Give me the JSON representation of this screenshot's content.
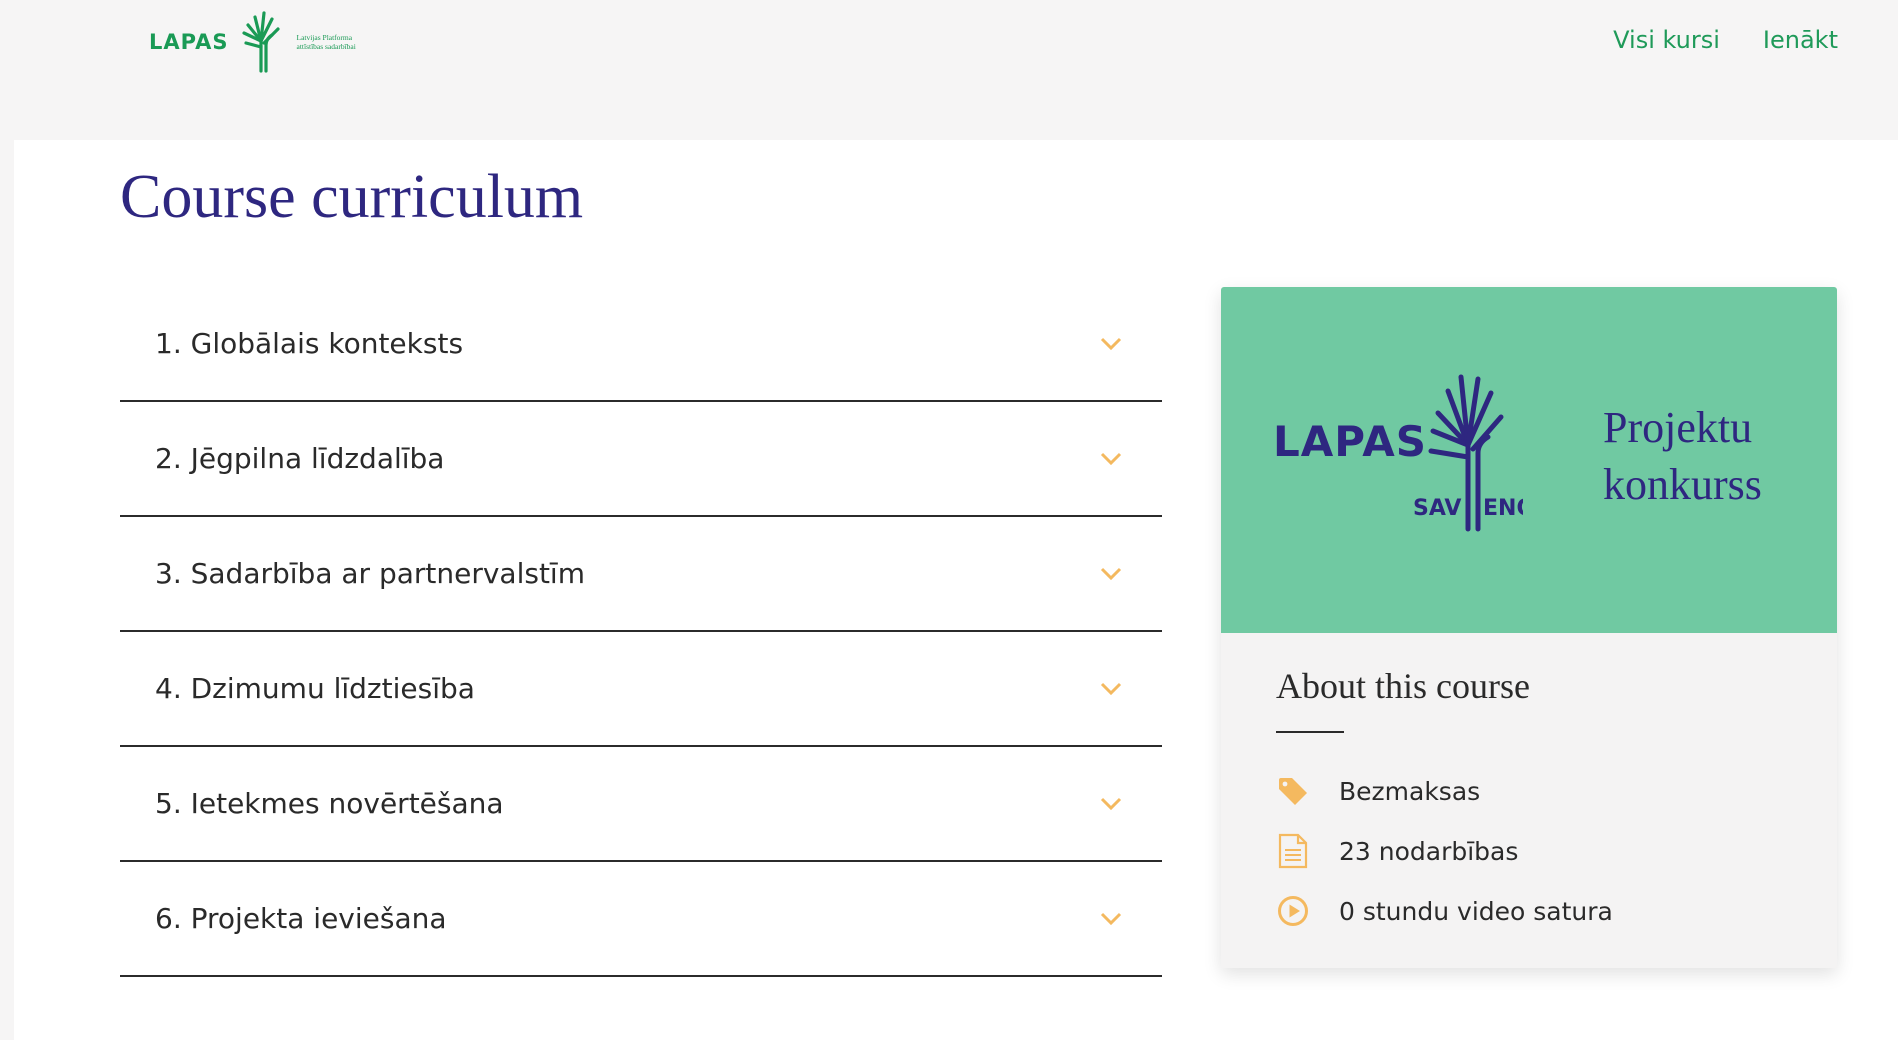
{
  "header": {
    "logo_text": "LAPAS",
    "logo_subtitle_line1": "Latvijas Platforma",
    "logo_subtitle_line2": "attīstības sadarbībai",
    "nav": [
      {
        "label": "Visi kursi"
      },
      {
        "label": "Ienākt"
      }
    ]
  },
  "main": {
    "title": "Course curriculum",
    "sections": [
      {
        "label": "1. Globālais konteksts"
      },
      {
        "label": "2. Jēgpilna līdzdalība"
      },
      {
        "label": "3. Sadarbība ar partnervalstīm"
      },
      {
        "label": "4. Dzimumu līdztiesība"
      },
      {
        "label": "5. Ietekmes novērtēšana"
      },
      {
        "label": "6. Projekta ieviešana"
      }
    ]
  },
  "card": {
    "banner": {
      "logo_text": "LAPAS",
      "logo_sub_left": "SAV",
      "logo_sub_right": "ENO",
      "line1": "Projektu",
      "line2": "konkurss",
      "bg_color": "#70c9a2",
      "text_color": "#2e2780"
    },
    "about_title": "About this course",
    "info": [
      {
        "icon": "tag-icon",
        "text": "Bezmaksas"
      },
      {
        "icon": "document-icon",
        "text": "23 nodarbības"
      },
      {
        "icon": "play-icon",
        "text": "0 stundu video satura"
      }
    ]
  },
  "colors": {
    "brand_green": "#1f9a59",
    "accent_orange": "#f4b95f",
    "title_purple": "#2e2780"
  }
}
